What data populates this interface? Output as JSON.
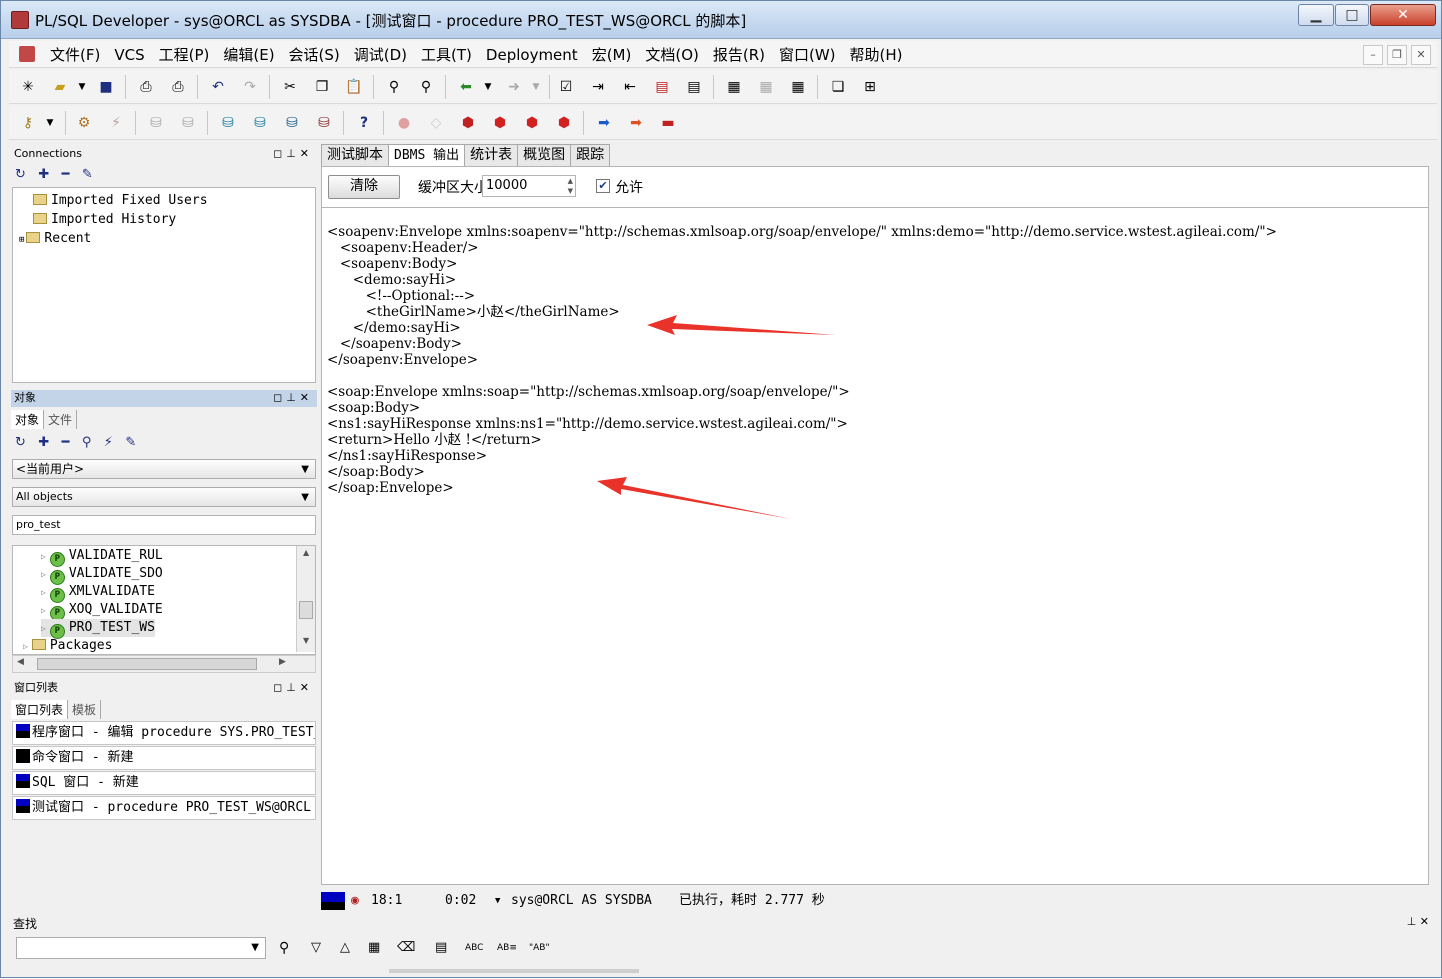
{
  "window": {
    "title": "PL/SQL Developer - sys@ORCL as SYSDBA - [测试窗口 - procedure PRO_TEST_WS@ORCL 的脚本]",
    "min": "▁",
    "max": "□",
    "close": "✕"
  },
  "menu": [
    "文件(F)",
    "VCS",
    "工程(P)",
    "编辑(E)",
    "会话(S)",
    "调试(D)",
    "工具(T)",
    "Deployment",
    "宏(M)",
    "文档(O)",
    "报告(R)",
    "窗口(W)",
    "帮助(H)"
  ],
  "mdi": {
    "min": "–",
    "restore": "❐",
    "close": "✕"
  },
  "connections": {
    "title": "Connections",
    "items": [
      "Imported Fixed Users",
      "Imported History",
      "Recent"
    ]
  },
  "objects": {
    "title": "对象",
    "tabs": [
      "对象",
      "文件"
    ],
    "owner": "<当前用户>",
    "filter": "All objects",
    "search": "pro_test",
    "items": [
      "VALIDATE_RUL",
      "VALIDATE_SDO",
      "XMLVALIDATE",
      "XOQ_VALIDATE",
      "PRO_TEST_WS"
    ],
    "packages": "Packages"
  },
  "windowlist": {
    "title": "窗口列表",
    "tabs": [
      "窗口列表",
      "模板"
    ],
    "items": [
      "程序窗口 - 编辑 procedure SYS.PRO_TEST_WS",
      "命令窗口 - 新建",
      "SQL 窗口 - 新建",
      "测试窗口 - procedure PRO_TEST_WS@ORCL"
    ]
  },
  "tabs": [
    "测试脚本",
    "DBMS 输出",
    "统计表",
    "概览图",
    "跟踪"
  ],
  "dbms": {
    "clear": "清除",
    "buffer_label": "缓冲区大小",
    "buffer_value": "10000",
    "enable_label": "允许"
  },
  "output_lines": [
    "<soapenv:Envelope xmlns:soapenv=\"http://schemas.xmlsoap.org/soap/envelope/\" xmlns:demo=\"http://demo.service.wstest.agileai.com/\">",
    "   <soapenv:Header/>",
    "   <soapenv:Body>",
    "      <demo:sayHi>",
    "         <!--Optional:-->",
    "         <theGirlName>小赵</theGirlName>",
    "      </demo:sayHi>",
    "   </soapenv:Body>",
    "</soapenv:Envelope>",
    "",
    "<soap:Envelope xmlns:soap=\"http://schemas.xmlsoap.org/soap/envelope/\">",
    "<soap:Body>",
    "<ns1:sayHiResponse xmlns:ns1=\"http://demo.service.wstest.agileai.com/\">",
    "<return>Hello 小赵 !</return>",
    "</ns1:sayHiResponse>",
    "</soap:Body>",
    "</soap:Envelope>"
  ],
  "status": {
    "position": "18:1",
    "time": "0:02",
    "connection": "sys@ORCL AS SYSDBA",
    "message": "已执行，耗时 2.777 秒"
  },
  "find": {
    "title": "查找",
    "abc1": "ABC",
    "abc2": "AB≡",
    "abc3": "\"AB\""
  },
  "colors": {
    "accent": "#0000c0",
    "arrow": "#e8322a"
  }
}
